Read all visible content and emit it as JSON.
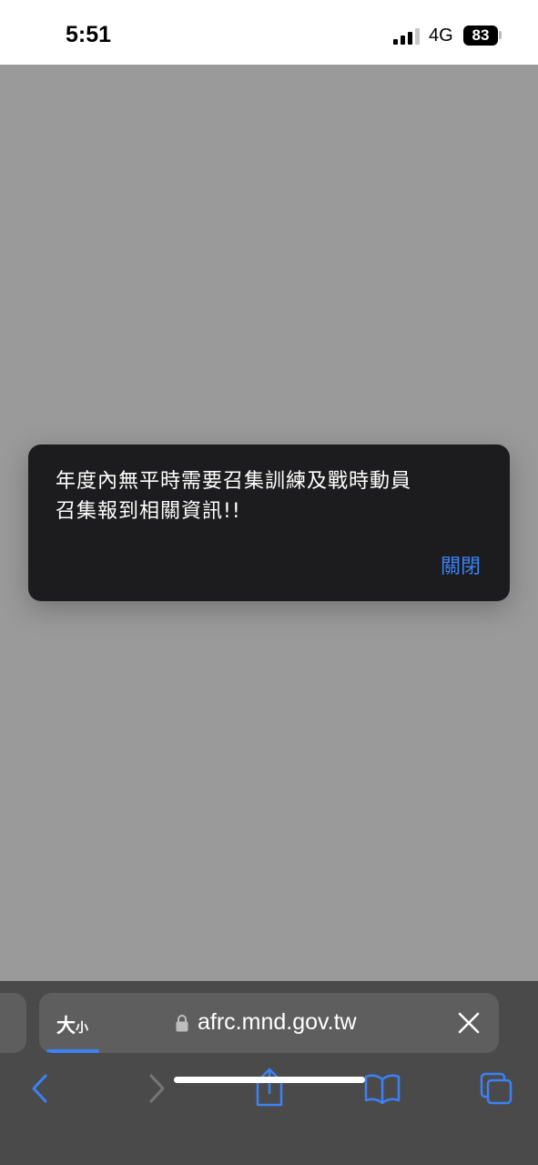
{
  "status_bar": {
    "time": "5:51",
    "network": "4G",
    "battery": "83"
  },
  "dialog": {
    "message_line1": "年度內無平時需要召集訓練及戰時動員",
    "message_line2": "召集報到相關資訊!!",
    "close_label": "關閉"
  },
  "toolbar": {
    "text_size_big": "大",
    "text_size_small": "小",
    "url": "afrc.mnd.gov.tw"
  },
  "icons": {
    "back": "chevron-left-icon",
    "forward": "chevron-right-icon",
    "share": "share-icon",
    "bookmarks": "book-icon",
    "tabs": "tabs-icon",
    "lock": "lock-icon",
    "clear": "close-icon"
  },
  "colors": {
    "accent": "#3b82f6",
    "dialog_bg": "#1c1c1e",
    "page_overlay": "#9a9a9a"
  }
}
